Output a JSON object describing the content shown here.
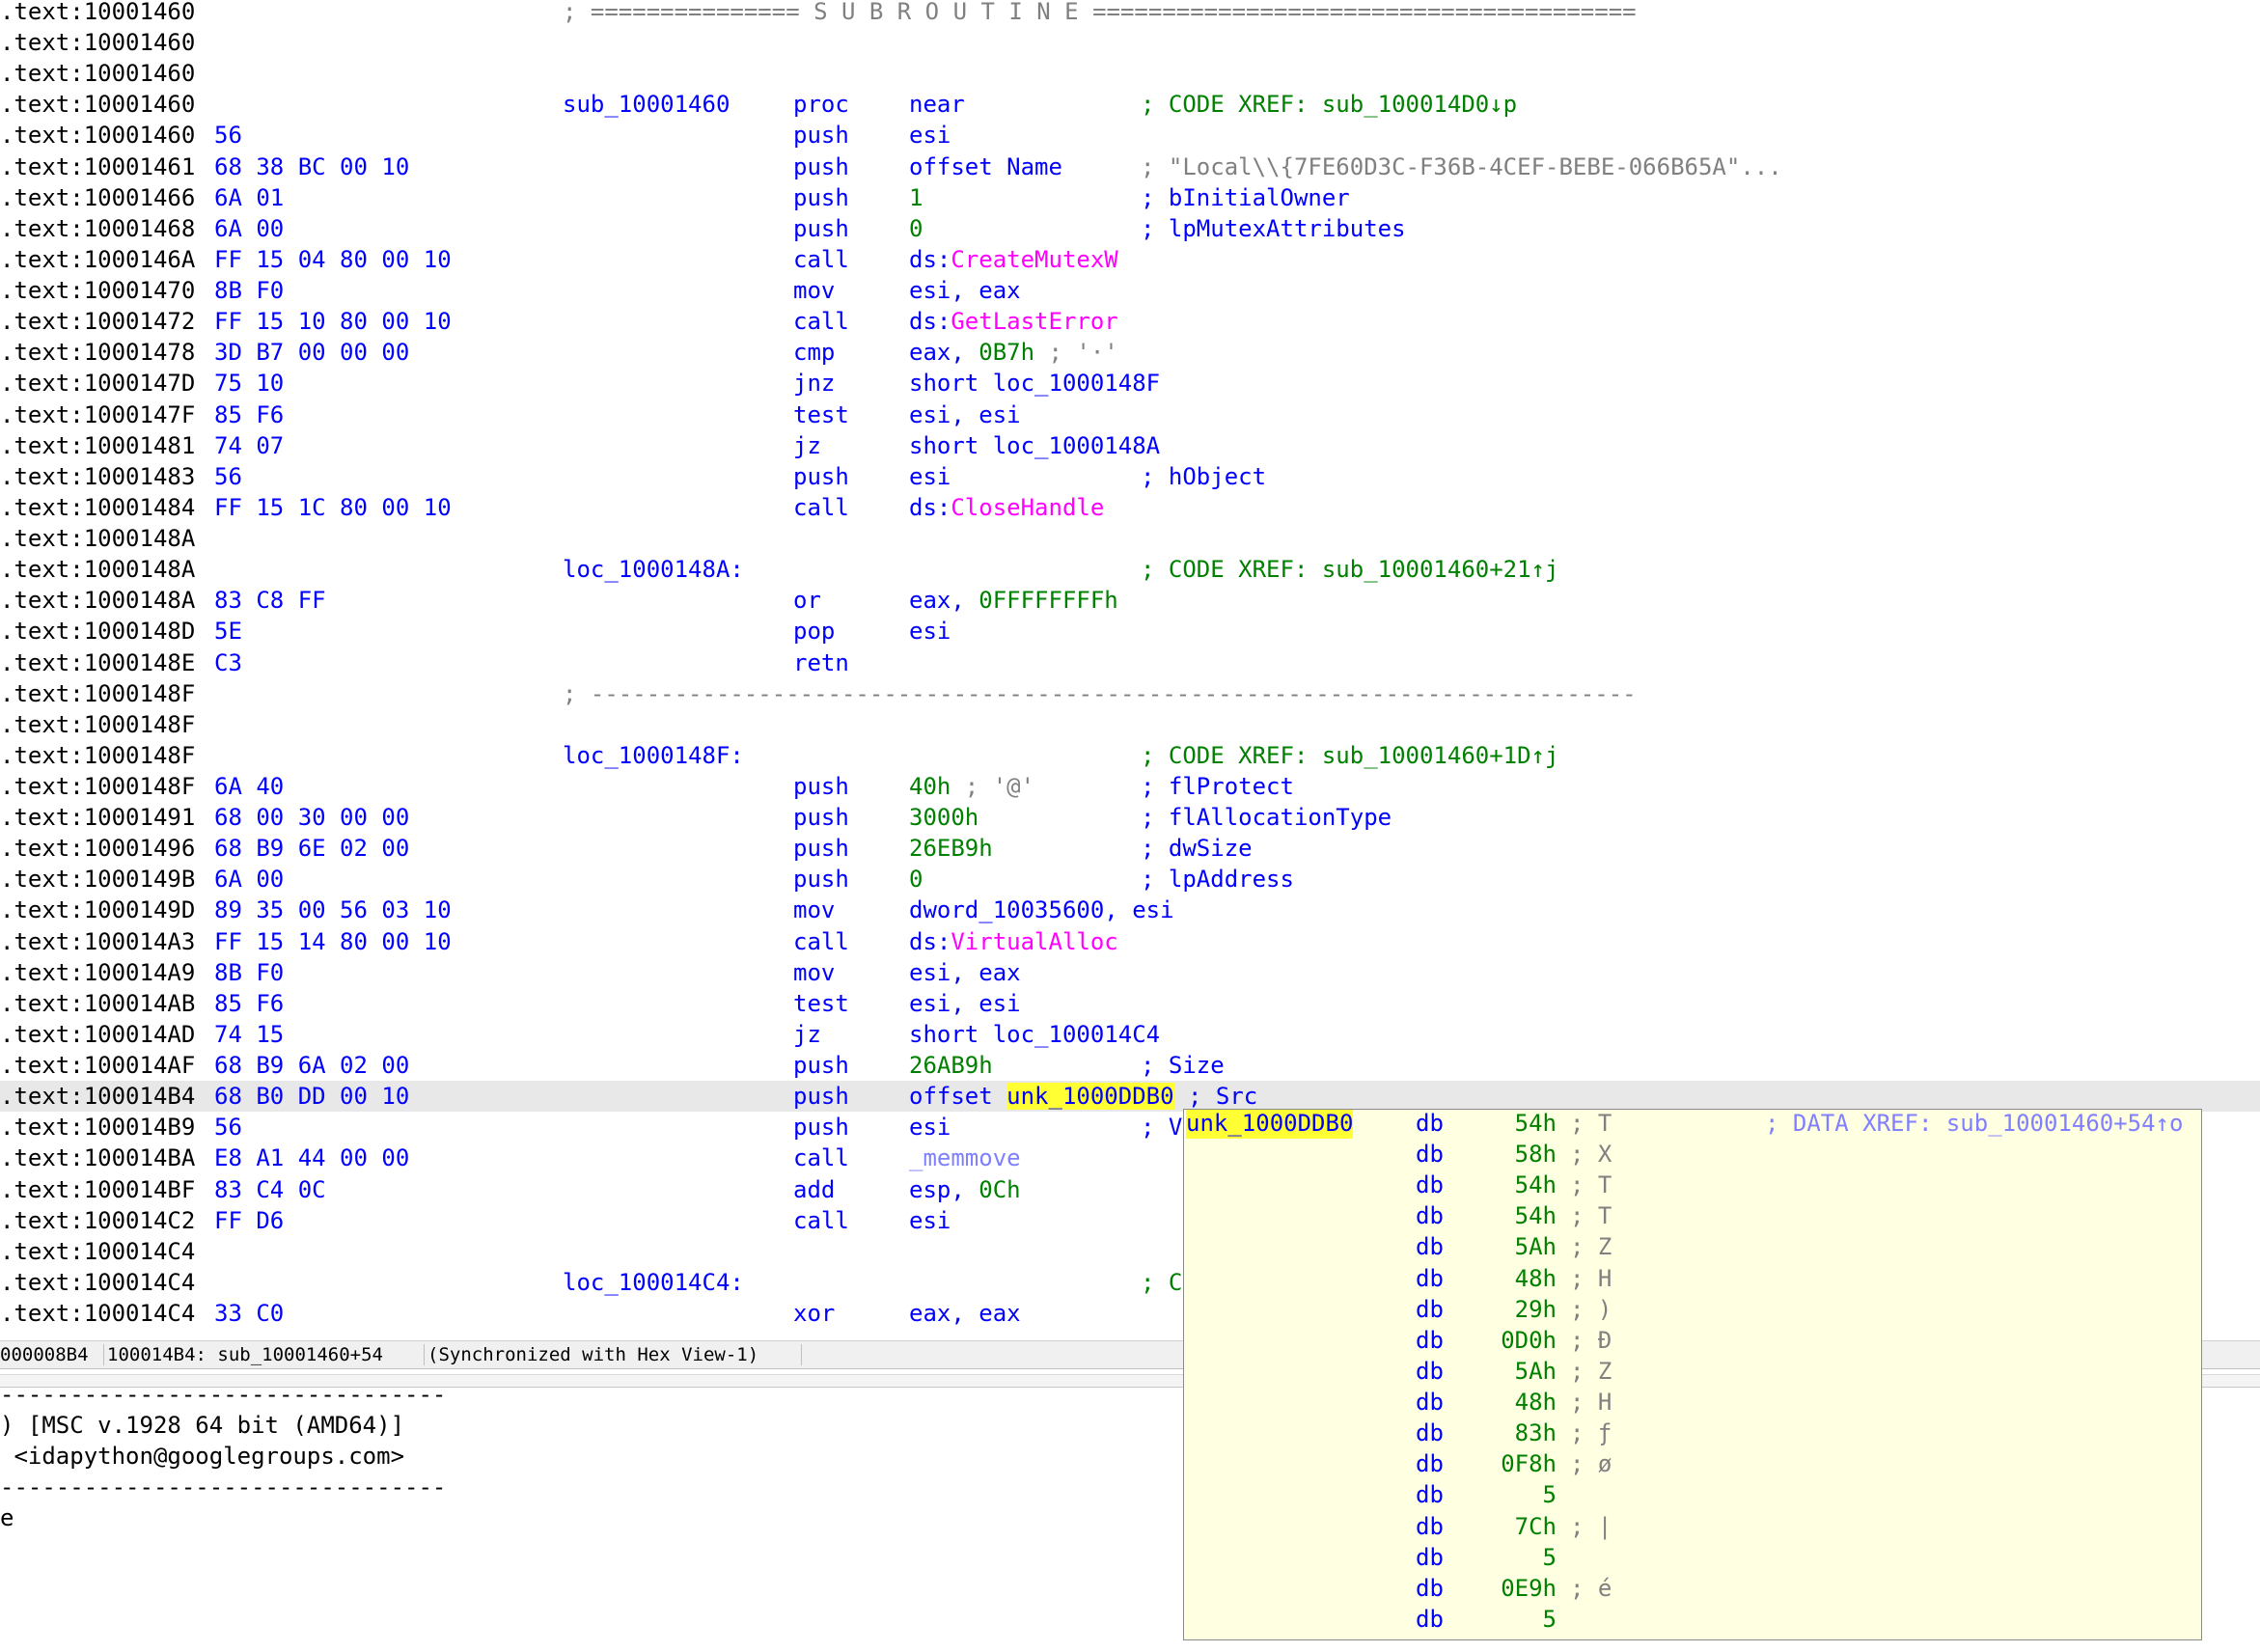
{
  "disasm": {
    "lines": [
      {
        "addr": ".text:10001460",
        "sep": "; =============== S U B R O U T I N E ======================================="
      },
      {
        "addr": ".text:10001460"
      },
      {
        "addr": ".text:10001460"
      },
      {
        "addr": ".text:10001460",
        "label": "sub_10001460",
        "mnem": "proc",
        "ops": "near",
        "cmt": "; CODE XREF: sub_100014D0↓p",
        "cmt_class": "g"
      },
      {
        "addr": ".text:10001460",
        "bytes": "56",
        "mnem": "push",
        "ops": "esi"
      },
      {
        "addr": ".text:10001461",
        "bytes": "68 38 BC 00 10",
        "mnem": "push",
        "ops": "offset Name",
        "cmt": "; \"Local\\\\{7FE60D3C-F36B-4CEF-BEBE-066B65A\"...",
        "cmt_class": "gr"
      },
      {
        "addr": ".text:10001466",
        "bytes": "6A 01",
        "mnem": "push",
        "ops": "1",
        "ops_class": "g",
        "cmt": "; bInitialOwner",
        "cmt_class": "b"
      },
      {
        "addr": ".text:10001468",
        "bytes": "6A 00",
        "mnem": "push",
        "ops": "0",
        "ops_class": "g",
        "cmt": "; lpMutexAttributes",
        "cmt_class": "b"
      },
      {
        "addr": ".text:1000146A",
        "bytes": "FF 15 04 80 00 10",
        "mnem": "call",
        "ops": "ds:",
        "ops_fn": "CreateMutexW"
      },
      {
        "addr": ".text:10001470",
        "bytes": "8B F0",
        "mnem": "mov",
        "ops": "esi, eax"
      },
      {
        "addr": ".text:10001472",
        "bytes": "FF 15 10 80 00 10",
        "mnem": "call",
        "ops": "ds:",
        "ops_fn": "GetLastError"
      },
      {
        "addr": ".text:10001478",
        "bytes": "3D B7 00 00 00",
        "mnem": "cmp",
        "ops": "eax, ",
        "ops_num": "0B7h",
        "ops_tail": " ; '·'"
      },
      {
        "addr": ".text:1000147D",
        "bytes": "75 10",
        "mnem": "jnz",
        "ops": "short loc_1000148F"
      },
      {
        "addr": ".text:1000147F",
        "bytes": "85 F6",
        "mnem": "test",
        "ops": "esi, esi"
      },
      {
        "addr": ".text:10001481",
        "bytes": "74 07",
        "mnem": "jz",
        "ops": "short loc_1000148A"
      },
      {
        "addr": ".text:10001483",
        "bytes": "56",
        "mnem": "push",
        "ops": "esi",
        "cmt": "; hObject",
        "cmt_class": "b"
      },
      {
        "addr": ".text:10001484",
        "bytes": "FF 15 1C 80 00 10",
        "mnem": "call",
        "ops": "ds:",
        "ops_fn": "CloseHandle"
      },
      {
        "addr": ".text:1000148A"
      },
      {
        "addr": ".text:1000148A",
        "label": "loc_1000148A:",
        "cmt": "; CODE XREF: sub_10001460+21↑j",
        "cmt_class": "g"
      },
      {
        "addr": ".text:1000148A",
        "bytes": "83 C8 FF",
        "mnem": "or",
        "ops": "eax, ",
        "ops_num": "0FFFFFFFFh"
      },
      {
        "addr": ".text:1000148D",
        "bytes": "5E",
        "mnem": "pop",
        "ops": "esi"
      },
      {
        "addr": ".text:1000148E",
        "bytes": "C3",
        "mnem": "retn"
      },
      {
        "addr": ".text:1000148F",
        "sep": "; ---------------------------------------------------------------------------"
      },
      {
        "addr": ".text:1000148F"
      },
      {
        "addr": ".text:1000148F",
        "label": "loc_1000148F:",
        "cmt": "; CODE XREF: sub_10001460+1D↑j",
        "cmt_class": "g"
      },
      {
        "addr": ".text:1000148F",
        "bytes": "6A 40",
        "mnem": "push",
        "ops_num": "40h",
        "ops_tail": " ; '@'",
        "cmt": "; flProtect",
        "cmt_class": "b"
      },
      {
        "addr": ".text:10001491",
        "bytes": "68 00 30 00 00",
        "mnem": "push",
        "ops_num": "3000h",
        "cmt": "; flAllocationType",
        "cmt_class": "b"
      },
      {
        "addr": ".text:10001496",
        "bytes": "68 B9 6E 02 00",
        "mnem": "push",
        "ops_num": "26EB9h",
        "cmt": "; dwSize",
        "cmt_class": "b"
      },
      {
        "addr": ".text:1000149B",
        "bytes": "6A 00",
        "mnem": "push",
        "ops_num": "0",
        "cmt": "; lpAddress",
        "cmt_class": "b"
      },
      {
        "addr": ".text:1000149D",
        "bytes": "89 35 00 56 03 10",
        "mnem": "mov",
        "ops": "dword_10035600, esi"
      },
      {
        "addr": ".text:100014A3",
        "bytes": "FF 15 14 80 00 10",
        "mnem": "call",
        "ops": "ds:",
        "ops_fn": "VirtualAlloc"
      },
      {
        "addr": ".text:100014A9",
        "bytes": "8B F0",
        "mnem": "mov",
        "ops": "esi, eax"
      },
      {
        "addr": ".text:100014AB",
        "bytes": "85 F6",
        "mnem": "test",
        "ops": "esi, esi"
      },
      {
        "addr": ".text:100014AD",
        "bytes": "74 15",
        "mnem": "jz",
        "ops": "short loc_100014C4"
      },
      {
        "addr": ".text:100014AF",
        "bytes": "68 B9 6A 02 00",
        "mnem": "push",
        "ops_num": "26AB9h",
        "cmt": "; Size",
        "cmt_class": "b"
      },
      {
        "addr": ".text:100014B4",
        "bytes": "68 B0 DD 00 10",
        "mnem": "push",
        "ops": "offset ",
        "ops_hl": "unk_1000DDB0",
        "ops_tail2": " ; Src",
        "selected": true
      },
      {
        "addr": ".text:100014B9",
        "bytes": "56",
        "mnem": "push",
        "ops": "esi",
        "cmt": "; V",
        "cmt_class": "b"
      },
      {
        "addr": ".text:100014BA",
        "bytes": "E8 A1 44 00 00",
        "mnem": "call",
        "ops_sub": "_memmove"
      },
      {
        "addr": ".text:100014BF",
        "bytes": "83 C4 0C",
        "mnem": "add",
        "ops": "esp, ",
        "ops_num": "0Ch"
      },
      {
        "addr": ".text:100014C2",
        "bytes": "FF D6",
        "mnem": "call",
        "ops": "esi"
      },
      {
        "addr": ".text:100014C4"
      },
      {
        "addr": ".text:100014C4",
        "label": "loc_100014C4:",
        "cmt": "; C",
        "cmt_class": "g"
      },
      {
        "addr": ".text:100014C4",
        "bytes": "33 C0",
        "mnem": "xor",
        "ops": "eax, eax"
      }
    ]
  },
  "status": {
    "offset": "000008B4",
    "location": "100014B4: sub_10001460+54",
    "sync": "(Synchronized with Hex View-1)"
  },
  "output": {
    "lines": [
      "--------------------------------",
      ") [MSC v.1928 64 bit (AMD64)]",
      " <idapython@googlegroups.com>",
      "--------------------------------",
      "e"
    ]
  },
  "hint": {
    "name": "unk_1000DDB0",
    "xref": "; DATA XREF: sub_10001460+54↑o",
    "rows": [
      {
        "db": "db",
        "val": "54h",
        "ch": "; T"
      },
      {
        "db": "db",
        "val": "58h",
        "ch": "; X"
      },
      {
        "db": "db",
        "val": "54h",
        "ch": "; T"
      },
      {
        "db": "db",
        "val": "54h",
        "ch": "; T"
      },
      {
        "db": "db",
        "val": "5Ah",
        "ch": "; Z"
      },
      {
        "db": "db",
        "val": "48h",
        "ch": "; H"
      },
      {
        "db": "db",
        "val": "29h",
        "ch": "; )"
      },
      {
        "db": "db",
        "val": "0D0h",
        "ch": "; Ð"
      },
      {
        "db": "db",
        "val": "5Ah",
        "ch": "; Z"
      },
      {
        "db": "db",
        "val": "48h",
        "ch": "; H"
      },
      {
        "db": "db",
        "val": "83h",
        "ch": "; ƒ"
      },
      {
        "db": "db",
        "val": "0F8h",
        "ch": "; ø"
      },
      {
        "db": "db",
        "val": "5",
        "ch": ""
      },
      {
        "db": "db",
        "val": "7Ch",
        "ch": "; |"
      },
      {
        "db": "db",
        "val": "5",
        "ch": ""
      },
      {
        "db": "db",
        "val": "0E9h",
        "ch": "; é"
      },
      {
        "db": "db",
        "val": "5",
        "ch": ""
      }
    ]
  }
}
